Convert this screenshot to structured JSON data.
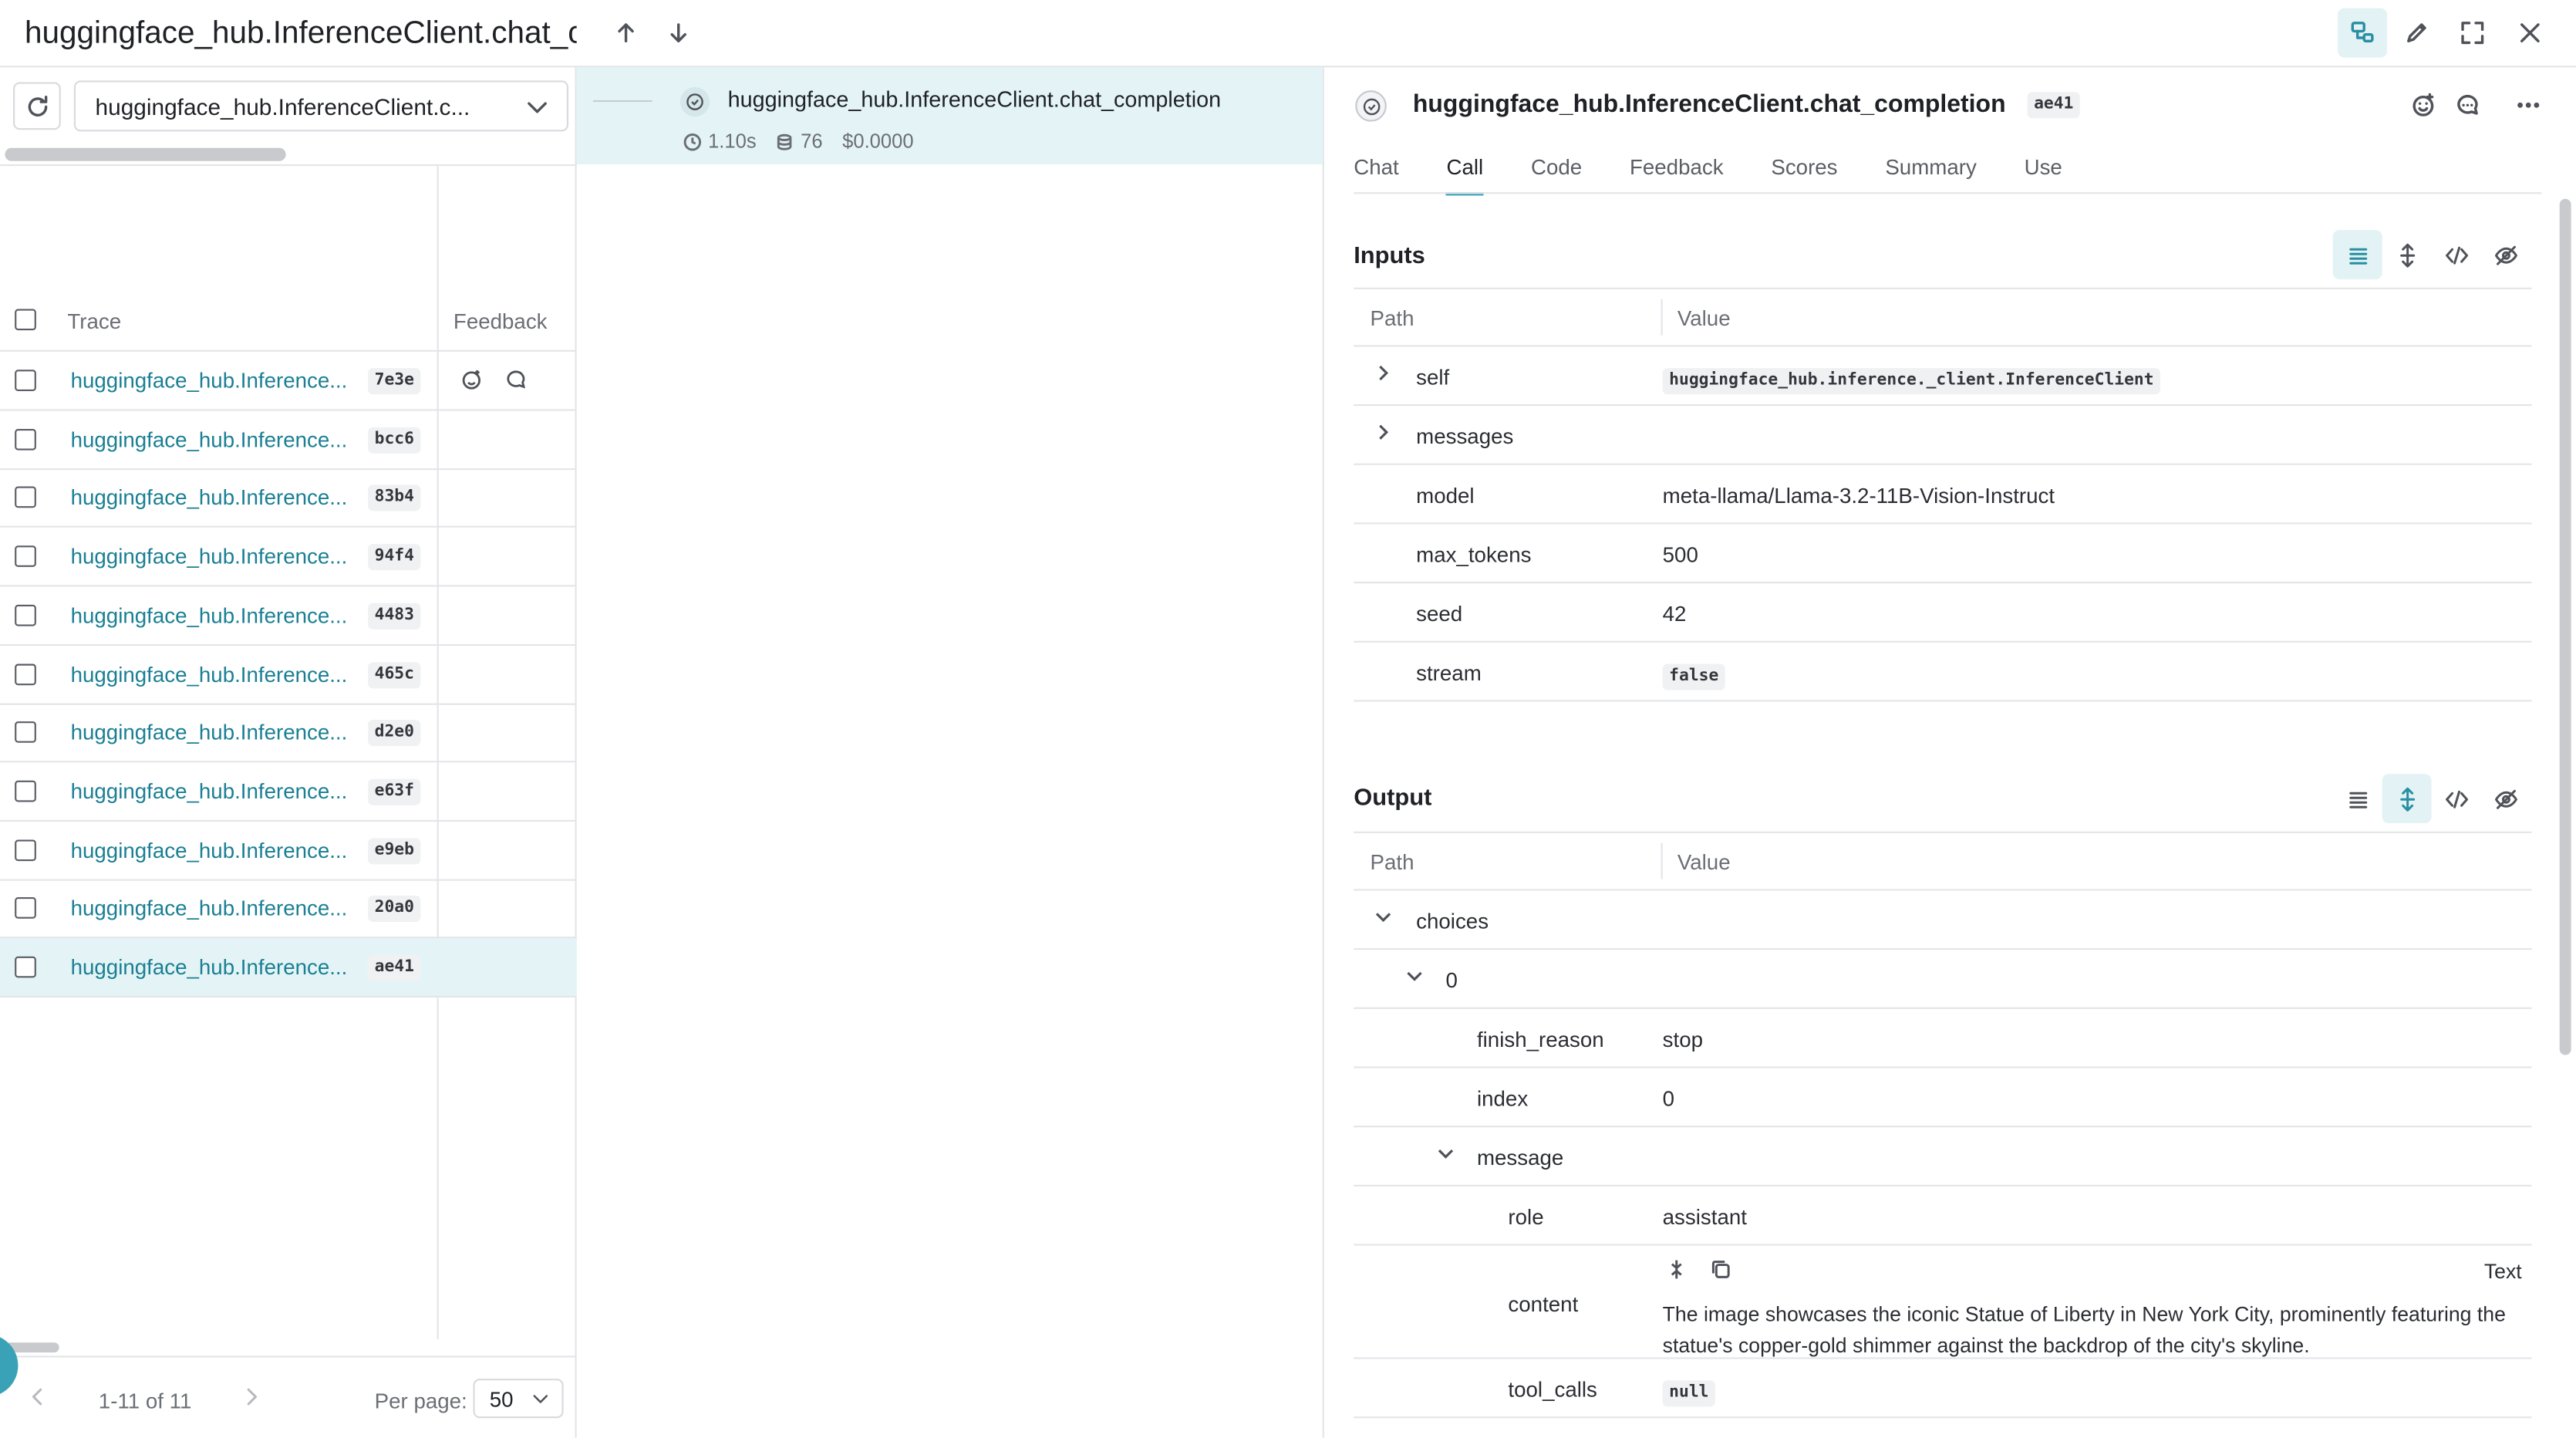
{
  "header": {
    "title": "huggingface_hub.InferenceClient.chat_completion"
  },
  "left": {
    "filter_value": "huggingface_hub.InferenceClient.c...",
    "columns": {
      "trace": "Trace",
      "feedback": "Feedback"
    },
    "rows": [
      {
        "name": "huggingface_hub.Inference...",
        "id": "7e3e"
      },
      {
        "name": "huggingface_hub.Inference...",
        "id": "bcc6"
      },
      {
        "name": "huggingface_hub.Inference...",
        "id": "83b4"
      },
      {
        "name": "huggingface_hub.Inference...",
        "id": "94f4"
      },
      {
        "name": "huggingface_hub.Inference...",
        "id": "4483"
      },
      {
        "name": "huggingface_hub.Inference...",
        "id": "465c"
      },
      {
        "name": "huggingface_hub.Inference...",
        "id": "d2e0"
      },
      {
        "name": "huggingface_hub.Inference...",
        "id": "e63f"
      },
      {
        "name": "huggingface_hub.Inference...",
        "id": "e9eb"
      },
      {
        "name": "huggingface_hub.Inference...",
        "id": "20a0"
      },
      {
        "name": "huggingface_hub.Inference...",
        "id": "ae41"
      }
    ],
    "pager": {
      "count": "1-11 of 11",
      "per_page_label": "Per page:",
      "per_page": "50"
    }
  },
  "trace": {
    "title": "huggingface_hub.InferenceClient.chat_completion",
    "duration": "1.10s",
    "tokens": "76",
    "cost": "$0.0000"
  },
  "call": {
    "title": "huggingface_hub.InferenceClient.chat_completion",
    "id": "ae41",
    "tabs": [
      "Chat",
      "Call",
      "Code",
      "Feedback",
      "Scores",
      "Summary",
      "Use"
    ],
    "inputs": {
      "title": "Inputs",
      "path_header": "Path",
      "value_header": "Value",
      "rows": {
        "self": {
          "key": "self",
          "value": "huggingface_hub.inference._client.InferenceClient"
        },
        "messages": {
          "key": "messages"
        },
        "model": {
          "key": "model",
          "value": "meta-llama/Llama-3.2-11B-Vision-Instruct"
        },
        "max_tokens": {
          "key": "max_tokens",
          "value": "500"
        },
        "seed": {
          "key": "seed",
          "value": "42"
        },
        "stream": {
          "key": "stream",
          "value": "false"
        }
      }
    },
    "output": {
      "title": "Output",
      "path_header": "Path",
      "value_header": "Value",
      "rows": {
        "choices": {
          "key": "choices"
        },
        "zero": {
          "key": "0"
        },
        "finish_reason": {
          "key": "finish_reason",
          "value": "stop"
        },
        "index": {
          "key": "index",
          "value": "0"
        },
        "message": {
          "key": "message"
        },
        "role": {
          "key": "role",
          "value": "assistant"
        },
        "content": {
          "key": "content",
          "type": "Text",
          "value": "The image showcases the iconic Statue of Liberty in New York City, prominently featuring the statue's copper-gold shimmer against the backdrop of the city's skyline."
        },
        "tool_calls": {
          "key": "tool_calls",
          "value": "null"
        }
      }
    }
  },
  "colors": {
    "accent": "#3aa2b6",
    "selected_row": "#e4f4f6",
    "link": "#1a7f93"
  }
}
